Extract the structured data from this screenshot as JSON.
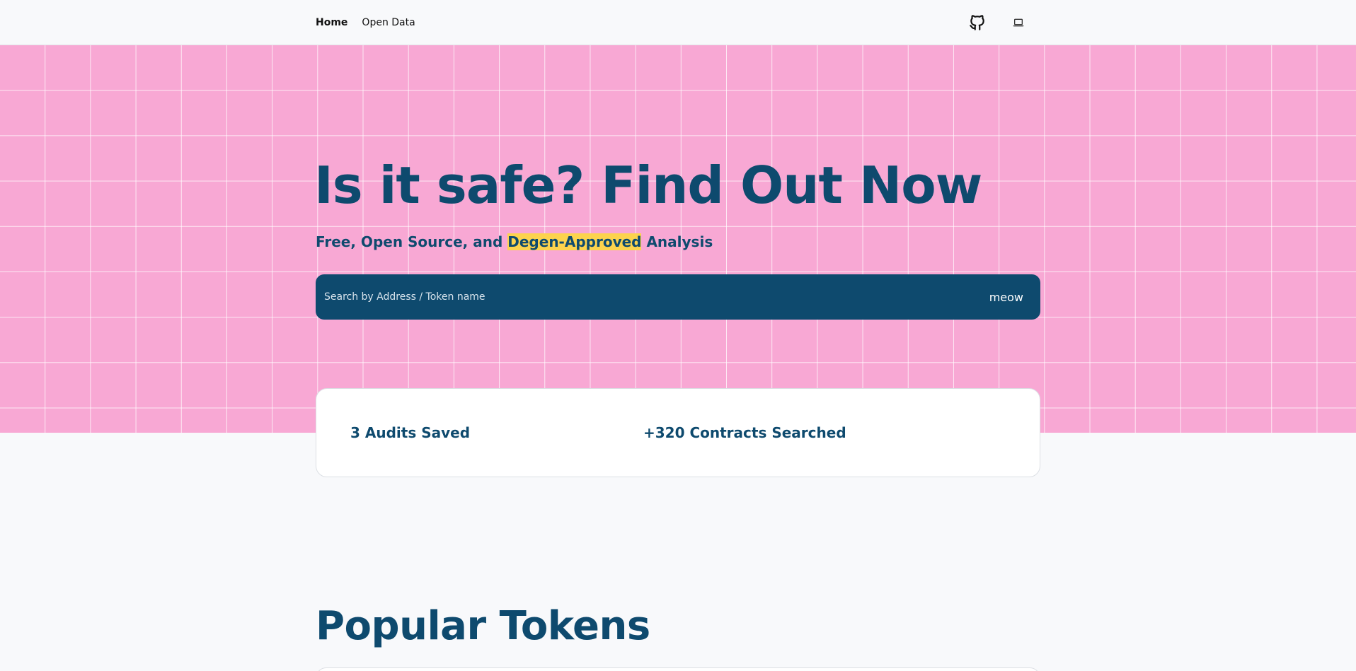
{
  "nav": {
    "links": [
      {
        "label": "Home",
        "active": true
      },
      {
        "label": "Open Data",
        "active": false
      }
    ],
    "icons": [
      "github-icon",
      "laptop-icon"
    ]
  },
  "hero": {
    "headline": "Is it safe? Find Out Now",
    "subline_before": "Free, Open Source, and ",
    "subline_highlight": "Degen-Approved",
    "subline_after": " Analysis",
    "background_color": "#f8a8d4",
    "highlight_color": "#fcd34d"
  },
  "search": {
    "placeholder": "Search by Address / Token name",
    "value": "",
    "button_label": "meow",
    "bar_color": "#0e4a6e"
  },
  "stats": {
    "audits": "3 Audits Saved",
    "contracts": "+320 Contracts Searched"
  },
  "popular": {
    "title": "Popular Tokens"
  }
}
